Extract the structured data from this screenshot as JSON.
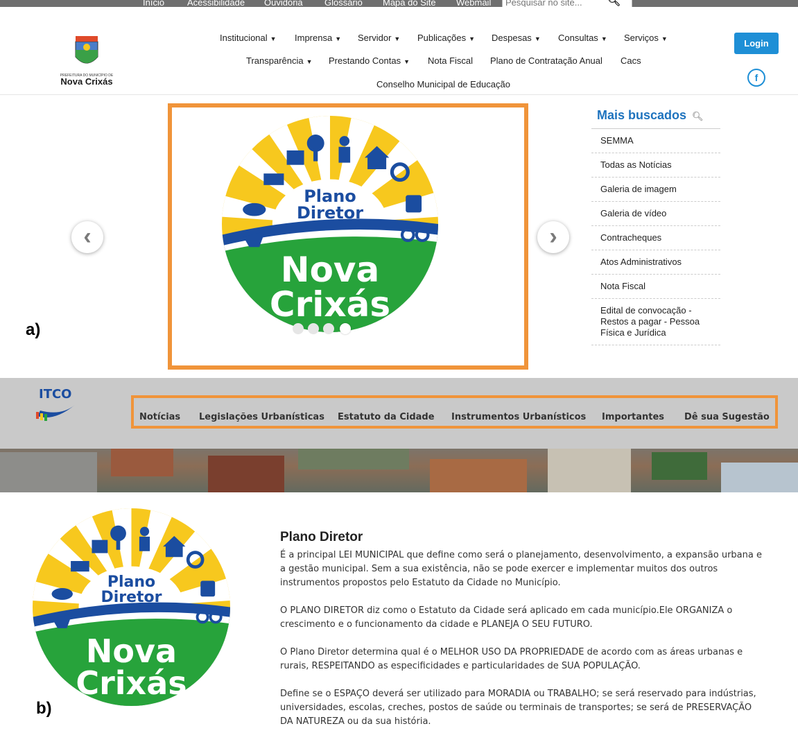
{
  "topbar": {
    "links": [
      "Início",
      "Acessibilidade",
      "Ouvidoria",
      "Glossário",
      "Mapa do Site",
      "Webmail"
    ],
    "search_placeholder": "Pesquisar no site..."
  },
  "header": {
    "logo_caption_small": "PREFEITURA DO MUNICÍPIO DE",
    "logo_caption": "Nova Crixás",
    "nav_row1": [
      "Institucional",
      "Imprensa",
      "Servidor",
      "Publicações",
      "Despesas",
      "Consultas",
      "Serviços"
    ],
    "nav_row2": [
      "Transparência",
      "Prestando Contas",
      "Nota Fiscal",
      "Plano de Contratação Anual",
      "Cacs"
    ],
    "nav_row3": [
      "Conselho Municipal de Educação"
    ],
    "login_label": "Login",
    "fb_label": "f"
  },
  "figure_labels": {
    "a": "a)",
    "b": "b)"
  },
  "carousel": {
    "logo_top_text": "Plano",
    "logo_mid_text": "Diretor",
    "logo_big1": "Nova",
    "logo_big2": "Crixás",
    "prev_glyph": "‹",
    "next_glyph": "›",
    "slides_count": 4,
    "active_index": 4
  },
  "mais_buscados": {
    "title": "Mais buscados",
    "items": [
      "SEMMA",
      "Todas as Notícias",
      "Galeria de imagem",
      "Galeria de vídeo",
      "Contracheques",
      "Atos Administrativos",
      "Nota Fiscal",
      "Edital de convocação - Restos a pagar - Pessoa Física e Jurídica"
    ]
  },
  "itco": {
    "logo_text": "ITCO",
    "menu": [
      "Notícias",
      "Legislações Urbanísticas",
      "Estatuto da Cidade",
      "Instrumentos Urbanísticos",
      "Importantes",
      "Dê sua Sugestão"
    ]
  },
  "plano": {
    "title": "Plano Diretor",
    "paragraphs": [
      "É a principal LEI MUNICIPAL que define como será o planejamento, desenvolvimento, a expansão urbana e a gestão municipal. Sem a sua existência, não se pode exercer e implementar muitos dos outros instrumentos propostos pelo Estatuto da Cidade no Município.",
      "O PLANO DIRETOR diz como o Estatuto da Cidade será aplicado em cada município.Ele ORGANIZA o crescimento e o funcionamento da cidade e PLANEJA O SEU FUTURO.",
      "O Plano Diretor determina qual é o MELHOR USO DA PROPRIEDADE de acordo com as áreas urbanas e rurais, RESPEITANDO as especificidades e particularidades de SUA POPULAÇÃO.",
      "Define se o ESPAÇO deverá ser utilizado para MORADIA ou TRABALHO; se será reservado para indústrias, universidades, escolas, creches, postos de saúde ou terminais de transportes; se será de PRESERVAÇÃO DA NATUREZA ou da sua história."
    ]
  },
  "colors": {
    "orange_frame": "#f0943a",
    "accent_blue": "#1e8fd6",
    "logo_green": "#27a33b",
    "logo_yellow": "#f7c81e",
    "logo_blue": "#1b4da0"
  }
}
